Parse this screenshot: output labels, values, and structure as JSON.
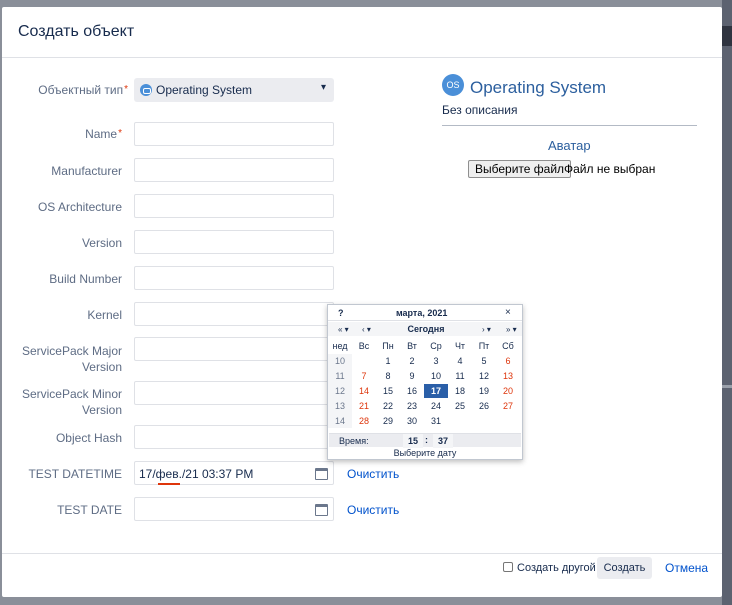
{
  "dialog": {
    "title": "Создать объект"
  },
  "form": {
    "object_type": {
      "label": "Объектный тип",
      "required": "*",
      "value": "Operating System"
    },
    "fields": [
      {
        "label": "Name",
        "required": "*"
      },
      {
        "label": "Manufacturer"
      },
      {
        "label": "OS Architecture"
      },
      {
        "label": "Version"
      },
      {
        "label": "Build Number"
      },
      {
        "label": "Kernel"
      },
      {
        "label": "ServicePack Major Version"
      },
      {
        "label": "ServicePack Minor Version"
      },
      {
        "label": "Object Hash"
      }
    ],
    "test_datetime": {
      "label": "TEST DATETIME",
      "value": "17/фев./21 03:37 PM",
      "clear_label": "Очистить"
    },
    "test_date": {
      "label": "TEST DATE",
      "value": "",
      "clear_label": "Очистить"
    }
  },
  "side": {
    "icon_text": "OS",
    "title": "Operating System",
    "description": "Без описания",
    "avatar_title": "Аватар",
    "file_button": "Выберите файл",
    "file_status": "Файл не выбран"
  },
  "calendar": {
    "help": "?",
    "month_year": "марта, 2021",
    "close": "×",
    "nav": {
      "prev_year": "« ▾",
      "prev_month": "‹ ▾",
      "today": "Сегодня",
      "next_month": "› ▾",
      "next_year": "» ▾"
    },
    "week_header": "нед",
    "days_of_week": [
      "Вс",
      "Пн",
      "Вт",
      "Ср",
      "Чт",
      "Пт",
      "Сб"
    ],
    "weeks": [
      {
        "week": "10",
        "days": [
          "",
          "1",
          "2",
          "3",
          "4",
          "5",
          "6"
        ]
      },
      {
        "week": "11",
        "days": [
          "7",
          "8",
          "9",
          "10",
          "11",
          "12",
          "13"
        ]
      },
      {
        "week": "12",
        "days": [
          "14",
          "15",
          "16",
          "17",
          "18",
          "19",
          "20"
        ]
      },
      {
        "week": "13",
        "days": [
          "21",
          "22",
          "23",
          "24",
          "25",
          "26",
          "27"
        ]
      },
      {
        "week": "14",
        "days": [
          "28",
          "29",
          "30",
          "31",
          "",
          "",
          ""
        ]
      }
    ],
    "selected_day": "17",
    "time_label": "Время:",
    "hour": "15",
    "colon": ":",
    "minute": "37",
    "status": "Выберите дату",
    "weekend_color": "#de350b",
    "selected_color": "#2a5fa8"
  },
  "footer": {
    "create_another_label": "Создать другой",
    "create_another_checked": false,
    "create_button": "Создать",
    "cancel_link": "Отмена"
  }
}
